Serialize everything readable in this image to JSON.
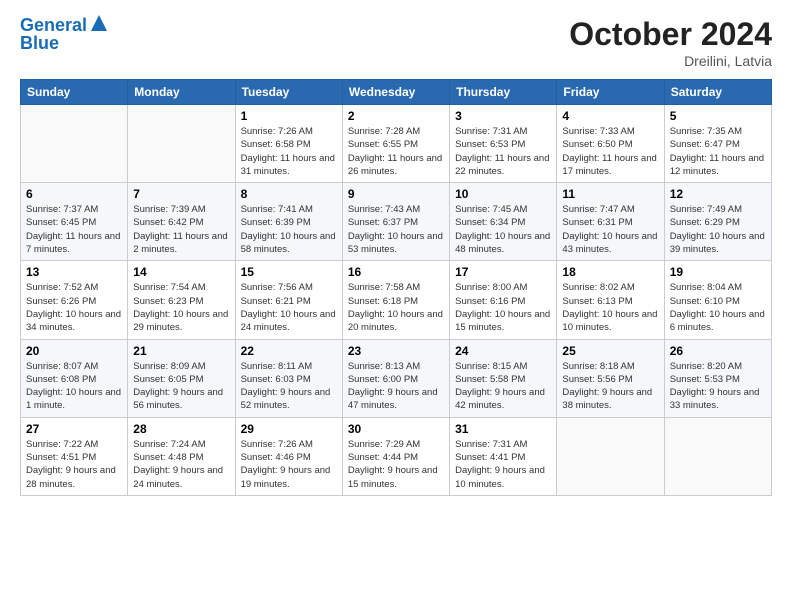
{
  "logo": {
    "line1": "General",
    "line2": "Blue"
  },
  "header": {
    "month": "October 2024",
    "location": "Dreilini, Latvia"
  },
  "weekdays": [
    "Sunday",
    "Monday",
    "Tuesday",
    "Wednesday",
    "Thursday",
    "Friday",
    "Saturday"
  ],
  "weeks": [
    [
      {
        "day": null
      },
      {
        "day": null
      },
      {
        "day": "1",
        "sunrise": "7:26 AM",
        "sunset": "6:58 PM",
        "daylight": "11 hours and 31 minutes."
      },
      {
        "day": "2",
        "sunrise": "7:28 AM",
        "sunset": "6:55 PM",
        "daylight": "11 hours and 26 minutes."
      },
      {
        "day": "3",
        "sunrise": "7:31 AM",
        "sunset": "6:53 PM",
        "daylight": "11 hours and 22 minutes."
      },
      {
        "day": "4",
        "sunrise": "7:33 AM",
        "sunset": "6:50 PM",
        "daylight": "11 hours and 17 minutes."
      },
      {
        "day": "5",
        "sunrise": "7:35 AM",
        "sunset": "6:47 PM",
        "daylight": "11 hours and 12 minutes."
      }
    ],
    [
      {
        "day": "6",
        "sunrise": "7:37 AM",
        "sunset": "6:45 PM",
        "daylight": "11 hours and 7 minutes."
      },
      {
        "day": "7",
        "sunrise": "7:39 AM",
        "sunset": "6:42 PM",
        "daylight": "11 hours and 2 minutes."
      },
      {
        "day": "8",
        "sunrise": "7:41 AM",
        "sunset": "6:39 PM",
        "daylight": "10 hours and 58 minutes."
      },
      {
        "day": "9",
        "sunrise": "7:43 AM",
        "sunset": "6:37 PM",
        "daylight": "10 hours and 53 minutes."
      },
      {
        "day": "10",
        "sunrise": "7:45 AM",
        "sunset": "6:34 PM",
        "daylight": "10 hours and 48 minutes."
      },
      {
        "day": "11",
        "sunrise": "7:47 AM",
        "sunset": "6:31 PM",
        "daylight": "10 hours and 43 minutes."
      },
      {
        "day": "12",
        "sunrise": "7:49 AM",
        "sunset": "6:29 PM",
        "daylight": "10 hours and 39 minutes."
      }
    ],
    [
      {
        "day": "13",
        "sunrise": "7:52 AM",
        "sunset": "6:26 PM",
        "daylight": "10 hours and 34 minutes."
      },
      {
        "day": "14",
        "sunrise": "7:54 AM",
        "sunset": "6:23 PM",
        "daylight": "10 hours and 29 minutes."
      },
      {
        "day": "15",
        "sunrise": "7:56 AM",
        "sunset": "6:21 PM",
        "daylight": "10 hours and 24 minutes."
      },
      {
        "day": "16",
        "sunrise": "7:58 AM",
        "sunset": "6:18 PM",
        "daylight": "10 hours and 20 minutes."
      },
      {
        "day": "17",
        "sunrise": "8:00 AM",
        "sunset": "6:16 PM",
        "daylight": "10 hours and 15 minutes."
      },
      {
        "day": "18",
        "sunrise": "8:02 AM",
        "sunset": "6:13 PM",
        "daylight": "10 hours and 10 minutes."
      },
      {
        "day": "19",
        "sunrise": "8:04 AM",
        "sunset": "6:10 PM",
        "daylight": "10 hours and 6 minutes."
      }
    ],
    [
      {
        "day": "20",
        "sunrise": "8:07 AM",
        "sunset": "6:08 PM",
        "daylight": "10 hours and 1 minute."
      },
      {
        "day": "21",
        "sunrise": "8:09 AM",
        "sunset": "6:05 PM",
        "daylight": "9 hours and 56 minutes."
      },
      {
        "day": "22",
        "sunrise": "8:11 AM",
        "sunset": "6:03 PM",
        "daylight": "9 hours and 52 minutes."
      },
      {
        "day": "23",
        "sunrise": "8:13 AM",
        "sunset": "6:00 PM",
        "daylight": "9 hours and 47 minutes."
      },
      {
        "day": "24",
        "sunrise": "8:15 AM",
        "sunset": "5:58 PM",
        "daylight": "9 hours and 42 minutes."
      },
      {
        "day": "25",
        "sunrise": "8:18 AM",
        "sunset": "5:56 PM",
        "daylight": "9 hours and 38 minutes."
      },
      {
        "day": "26",
        "sunrise": "8:20 AM",
        "sunset": "5:53 PM",
        "daylight": "9 hours and 33 minutes."
      }
    ],
    [
      {
        "day": "27",
        "sunrise": "7:22 AM",
        "sunset": "4:51 PM",
        "daylight": "9 hours and 28 minutes."
      },
      {
        "day": "28",
        "sunrise": "7:24 AM",
        "sunset": "4:48 PM",
        "daylight": "9 hours and 24 minutes."
      },
      {
        "day": "29",
        "sunrise": "7:26 AM",
        "sunset": "4:46 PM",
        "daylight": "9 hours and 19 minutes."
      },
      {
        "day": "30",
        "sunrise": "7:29 AM",
        "sunset": "4:44 PM",
        "daylight": "9 hours and 15 minutes."
      },
      {
        "day": "31",
        "sunrise": "7:31 AM",
        "sunset": "4:41 PM",
        "daylight": "9 hours and 10 minutes."
      },
      {
        "day": null
      },
      {
        "day": null
      }
    ]
  ],
  "labels": {
    "sunrise": "Sunrise:",
    "sunset": "Sunset:",
    "daylight": "Daylight:"
  }
}
